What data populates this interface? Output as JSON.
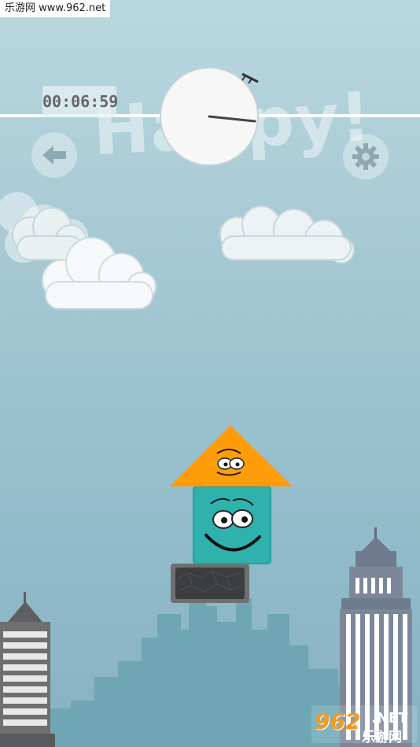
{
  "watermark": {
    "text": "乐游网 www.962.net"
  },
  "hud": {
    "timer": "00:06:59",
    "level_title": "Happy!"
  },
  "icons": {
    "back": "arrow-left-icon",
    "settings": "gear-icon",
    "clock": "clock-icon"
  },
  "blocks": {
    "triangle_color": "#ff9c0a",
    "square_color": "#2fb1ae",
    "base_color": "#3b3d3f"
  },
  "brand": {
    "number": "962",
    "suffix": ".NET",
    "text": "乐游网"
  },
  "colors": {
    "sky": "#a6c8d3",
    "building": "#6e7b8d"
  }
}
